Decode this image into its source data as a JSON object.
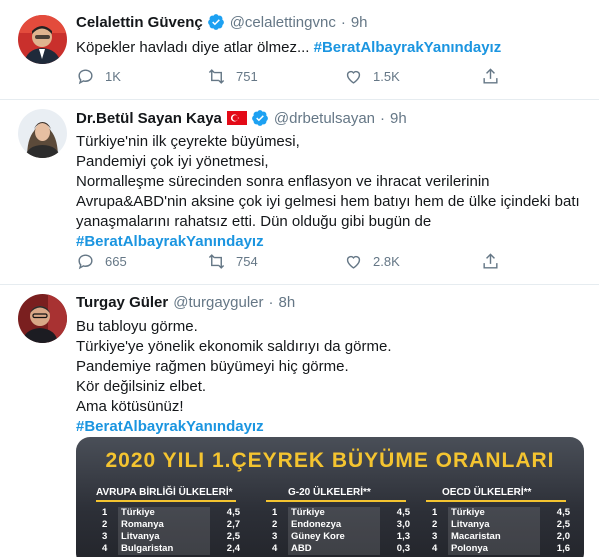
{
  "tweets": [
    {
      "name": "Celalettin Güvenç",
      "handle": "@celalettingvnc",
      "dot": "·",
      "time": "9h",
      "text_lines": [
        "Köpekler havladı diye atlar ölmez..."
      ],
      "hashtag": "#BeratAlbayrakYanındayız",
      "reply_count": "1K",
      "retweet_count": "751",
      "like_count": "1.5K"
    },
    {
      "name": "Dr.Betül Sayan Kaya",
      "handle": "@drbetulsayan",
      "dot": "·",
      "time": "9h",
      "text_lines": [
        "Türkiye'nin ilk çeyrekte büyümesi,",
        "Pandemiyi çok iyi yönetmesi,",
        "Normalleşme sürecinden sonra enflasyon ve ihracat verilerinin",
        "Avrupa&ABD'nin aksine çok iyi gelmesi hem batıyı hem de ülke içindeki batı",
        "yanaşmalarını rahatsız etti. Dün olduğu gibi bugün de"
      ],
      "hashtag": "#BeratAlbayrakYanındayız",
      "reply_count": "665",
      "retweet_count": "754",
      "like_count": "2.8K"
    },
    {
      "name": "Turgay Güler",
      "handle": "@turgayguler",
      "dot": "·",
      "time": "8h",
      "text_lines": [
        "Bu tabloyu görme.",
        "Türkiye'ye yönelik ekonomik saldırıyı da görme.",
        "Pandemiye rağmen büyümeyi hiç görme.",
        "Kör değilsiniz elbet.",
        "Ama kötüsünüz!"
      ],
      "hashtag": "#BeratAlbayrakYanındayız",
      "media": {
        "title": "2020 YILI 1.ÇEYREK BÜYÜME ORANLARI",
        "groups": [
          {
            "title": "AVRUPA BİRLİĞİ ÜLKELERİ*",
            "rows": [
              {
                "rank": "1",
                "country": "Türkiye",
                "value": "4,5"
              },
              {
                "rank": "2",
                "country": "Romanya",
                "value": "2,7"
              },
              {
                "rank": "3",
                "country": "Litvanya",
                "value": "2,5"
              },
              {
                "rank": "4",
                "country": "Bulgaristan",
                "value": "2,4"
              }
            ]
          },
          {
            "title": "G-20 ÜLKELERİ**",
            "rows": [
              {
                "rank": "1",
                "country": "Türkiye",
                "value": "4,5"
              },
              {
                "rank": "2",
                "country": "Endonezya",
                "value": "3,0"
              },
              {
                "rank": "3",
                "country": "Güney Kore",
                "value": "1,3"
              },
              {
                "rank": "4",
                "country": "ABD",
                "value": "0,3"
              }
            ]
          },
          {
            "title": "OECD ÜLKELERİ**",
            "rows": [
              {
                "rank": "1",
                "country": "Türkiye",
                "value": "4,5"
              },
              {
                "rank": "2",
                "country": "Litvanya",
                "value": "2,5"
              },
              {
                "rank": "3",
                "country": "Macaristan",
                "value": "2,0"
              },
              {
                "rank": "4",
                "country": "Polonya",
                "value": "1,6"
              }
            ]
          }
        ]
      }
    }
  ],
  "colors": {
    "link": "#1b95e0",
    "muted": "#657786",
    "verified": "#1da1f2",
    "chart_accent": "#f4c430"
  },
  "icons": [
    "verified-badge-icon",
    "turkish-flag-icon",
    "reply-icon",
    "retweet-icon",
    "like-icon",
    "share-icon"
  ]
}
